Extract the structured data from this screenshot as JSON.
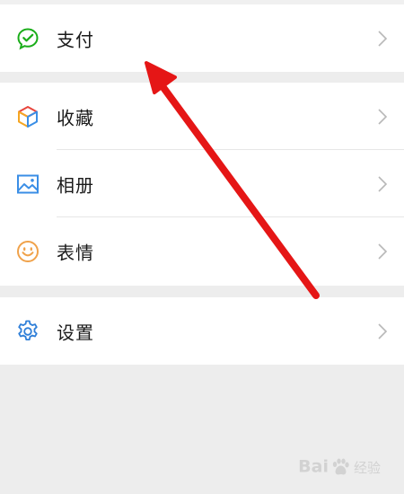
{
  "menu": {
    "pay_label": "支付",
    "favorites_label": "收藏",
    "album_label": "相册",
    "stickers_label": "表情",
    "settings_label": "设置"
  },
  "icons": {
    "pay": "wechat-pay-icon",
    "favorites": "cube-icon",
    "album": "picture-icon",
    "stickers": "smiley-icon",
    "settings": "gear-icon",
    "chevron": "chevron-right-icon"
  },
  "colors": {
    "pay_green": "#1aad19",
    "album_blue": "#3a8ee6",
    "sticker_orange": "#f0a24a",
    "settings_blue": "#2f7fd8",
    "annotation_arrow": "#e51616",
    "background": "#ededed"
  },
  "watermark": {
    "brand_left": "Bai",
    "brand_right": "经验"
  }
}
